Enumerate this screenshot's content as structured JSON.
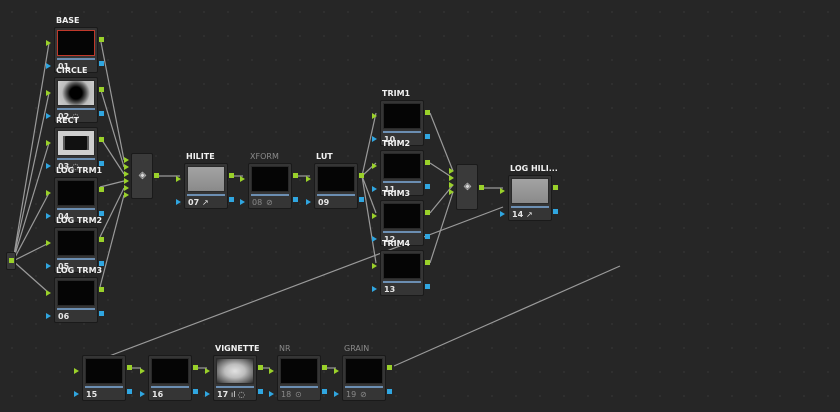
{
  "colors": {
    "background": "#262626",
    "node": "#353535",
    "pin_rgb": "#9ad12a",
    "pin_alpha": "#30a6e0",
    "wire": "#9a9a9a",
    "selected": "#c0392b"
  },
  "mixer_icon": "layer-mixer-icon",
  "nodes": [
    {
      "id": "n01",
      "label": "BASE",
      "num": "01",
      "icons": "",
      "thumb": "black",
      "disabled": false,
      "selected": true
    },
    {
      "id": "n02",
      "label": "CIRCLE",
      "num": "02",
      "icons": "◌",
      "thumb": "circle",
      "disabled": false,
      "selected": false
    },
    {
      "id": "n03",
      "label": "RECT",
      "num": "03",
      "icons": "◌",
      "thumb": "rect",
      "disabled": false,
      "selected": false
    },
    {
      "id": "n04",
      "label": "LOG TRM1",
      "num": "04",
      "icons": "",
      "thumb": "black",
      "disabled": false,
      "selected": false
    },
    {
      "id": "n05",
      "label": "LOG TRM2",
      "num": "05",
      "icons": "",
      "thumb": "black",
      "disabled": false,
      "selected": false
    },
    {
      "id": "n06",
      "label": "LOG TRM3",
      "num": "06",
      "icons": "",
      "thumb": "black",
      "disabled": false,
      "selected": false
    },
    {
      "id": "n07",
      "label": "HILITE",
      "num": "07",
      "icons": "↗",
      "thumb": "grey",
      "disabled": false,
      "selected": false
    },
    {
      "id": "n08",
      "label": "XFORM",
      "num": "08",
      "icons": "⊘",
      "thumb": "black",
      "disabled": true,
      "selected": false
    },
    {
      "id": "n09",
      "label": "LUT",
      "num": "09",
      "icons": "",
      "thumb": "black",
      "disabled": false,
      "selected": false
    },
    {
      "id": "n10",
      "label": "TRIM1",
      "num": "10",
      "icons": "",
      "thumb": "black",
      "disabled": false,
      "selected": false
    },
    {
      "id": "n11",
      "label": "TRIM2",
      "num": "11",
      "icons": "",
      "thumb": "black",
      "disabled": false,
      "selected": false
    },
    {
      "id": "n12",
      "label": "TRIM3",
      "num": "12",
      "icons": "",
      "thumb": "black",
      "disabled": false,
      "selected": false
    },
    {
      "id": "n13",
      "label": "TRIM4",
      "num": "13",
      "icons": "",
      "thumb": "black",
      "disabled": false,
      "selected": false
    },
    {
      "id": "n14",
      "label": "LOG HILI...",
      "num": "14",
      "icons": "↗",
      "thumb": "grey",
      "disabled": false,
      "selected": false
    },
    {
      "id": "n15",
      "label": "",
      "num": "15",
      "icons": "",
      "thumb": "black",
      "disabled": false,
      "selected": false
    },
    {
      "id": "n16",
      "label": "",
      "num": "16",
      "icons": "",
      "thumb": "black",
      "disabled": false,
      "selected": false
    },
    {
      "id": "n17",
      "label": "VIGNETTE",
      "num": "17",
      "icons": "ıl ◌",
      "thumb": "vignette",
      "disabled": false,
      "selected": false
    },
    {
      "id": "n18",
      "label": "NR",
      "num": "18",
      "icons": "⊙",
      "thumb": "black",
      "disabled": true,
      "selected": false
    },
    {
      "id": "n19",
      "label": "GRAIN",
      "num": "19",
      "icons": "⊘",
      "thumb": "black",
      "disabled": true,
      "selected": false
    }
  ]
}
